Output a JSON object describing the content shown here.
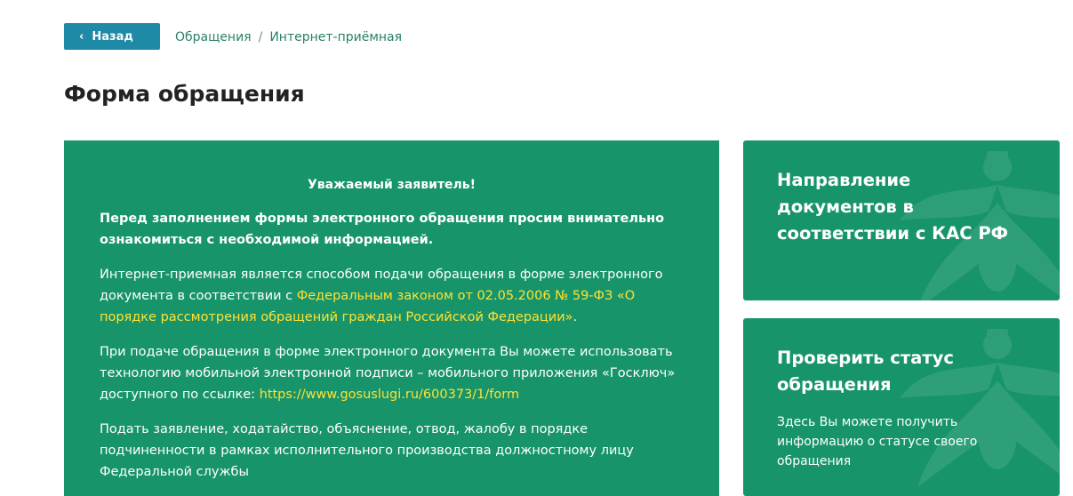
{
  "nav": {
    "back_label": "Назад",
    "breadcrumb": [
      "Обращения",
      "Интернет-приёмная"
    ],
    "separator": "/"
  },
  "page_title": "Форма обращения",
  "info": {
    "greeting": "Уважаемый заявитель!",
    "intro": "Перед заполнением формы электронного обращения просим внимательно ознакомиться с необходимой информацией.",
    "p1_text": "Интернет-приемная является способом подачи обращения в форме электронного документа в соответствии с ",
    "p1_link": "Федеральным законом от 02.05.2006 № 59-ФЗ «О порядке рассмотрения обращений граждан Российской Федерации»",
    "p1_end": ".",
    "p2_text": "При подаче обращения в форме электронного документа Вы можете использовать технологию мобильной электронной подписи – мобильного приложения «Госключ» доступного по ссылке: ",
    "p2_link": "https://www.gosuslugi.ru/600373/1/form",
    "p3_text": "Подать заявление, ходатайство, объяснение, отвод, жалобу в порядке подчиненности в рамках исполнительного производства должностному лицу Федеральной службы"
  },
  "cards": {
    "kas_title": "Направление документов в соответствии с КАС РФ",
    "status_title": "Проверить статус обращения",
    "status_desc": "Здесь Вы можете получить информацию о статусе своего обращения"
  },
  "colors": {
    "panel_green": "#17946a",
    "back_button": "#1f8aa6",
    "link_yellow": "#ffe233",
    "breadcrumb": "#2a7f6a"
  },
  "icons": {
    "back": "chevron-left-icon",
    "emblem": "eagle-emblem-watermark"
  }
}
